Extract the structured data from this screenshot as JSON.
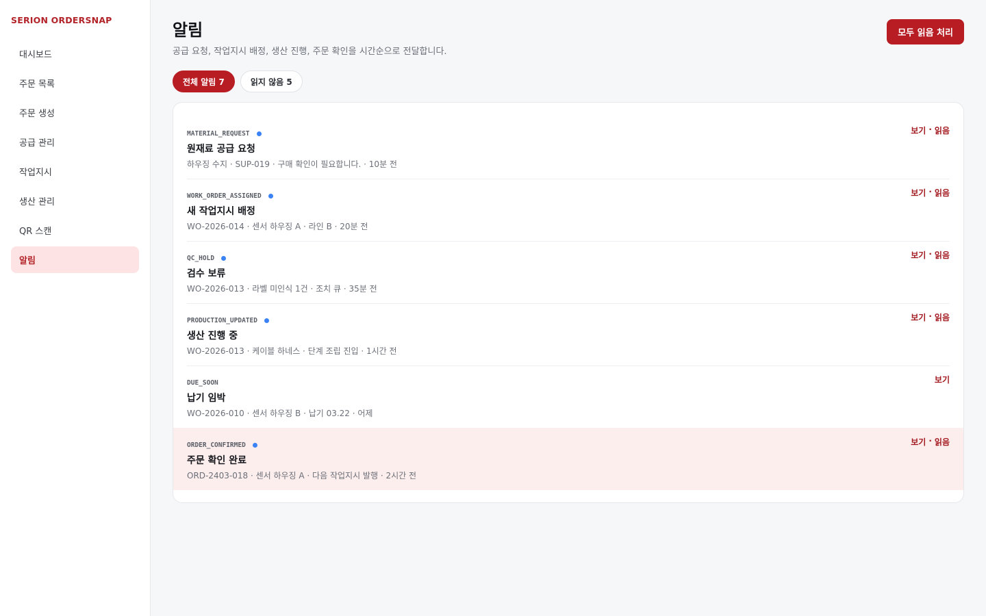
{
  "brand": "SERION ORDERSNAP",
  "nav": [
    {
      "label": "대시보드"
    },
    {
      "label": "주문 목록"
    },
    {
      "label": "주문 생성"
    },
    {
      "label": "공급 관리"
    },
    {
      "label": "작업지시"
    },
    {
      "label": "생산 관리"
    },
    {
      "label": "QR 스캔"
    },
    {
      "label": "알림"
    }
  ],
  "header": {
    "title": "알림",
    "subtitle": "공급 요청, 작업지시 배정, 생산 진행, 주문 확인을 시간순으로 전달합니다.",
    "mark_all_label": "모두 읽음 처리"
  },
  "filters": {
    "all_label": "전체 알림 7",
    "unread_label": "읽지 않음 5"
  },
  "actions": {
    "view": "보기",
    "separator": "·",
    "read": "읽음"
  },
  "notifications": [
    {
      "type": "MATERIAL_REQUEST",
      "title": "원재료 공급 요청",
      "meta": "하우징 수지 · SUP-019 · 구매 확인이 필요합니다. · 10분 전",
      "unread": true
    },
    {
      "type": "WORK_ORDER_ASSIGNED",
      "title": "새 작업지시 배정",
      "meta": "WO-2026-014 · 센서 하우징 A · 라인 B · 20분 전",
      "unread": true
    },
    {
      "type": "QC_HOLD",
      "title": "검수 보류",
      "meta": "WO-2026-013 · 라벨 미인식 1건 · 조치 큐 · 35분 전",
      "unread": true
    },
    {
      "type": "PRODUCTION_UPDATED",
      "title": "생산 진행 중",
      "meta": "WO-2026-013 · 케이블 하네스 · 단계 조립 진입 · 1시간 전",
      "unread": true
    },
    {
      "type": "DUE_SOON",
      "title": "납기 임박",
      "meta": "WO-2026-010 · 센서 하우징 B · 납기 03.22 · 어제",
      "unread": false
    },
    {
      "type": "ORDER_CONFIRMED",
      "title": "주문 확인 완료",
      "meta": "ORD-2403-018 · 센서 하우징 A · 다음 작업지시 발행 · 2시간 전",
      "unread": true
    }
  ],
  "colors": {
    "accent": "#b81d24",
    "active_bg": "#fde3e3",
    "unread_dot": "#3b82f6",
    "highlight_row": "#fdeeee"
  }
}
